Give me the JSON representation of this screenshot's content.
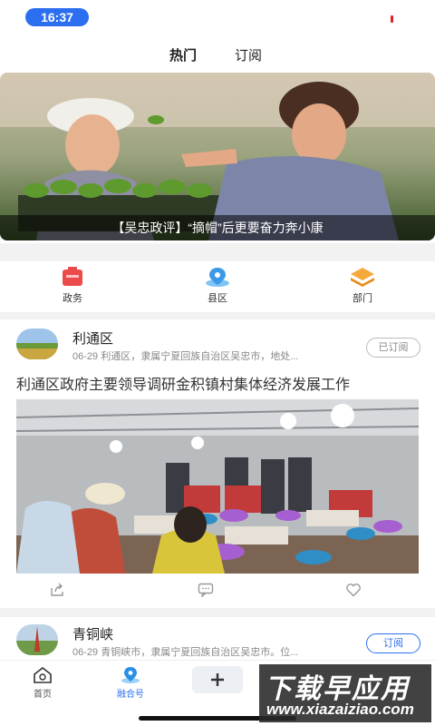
{
  "status": {
    "time": "16:37"
  },
  "top_tabs": [
    {
      "label": "热门"
    },
    {
      "label": "订阅"
    }
  ],
  "banner": {
    "caption": "【吴忠政评】“摘帽”后更要奋力奔小康"
  },
  "categories": [
    {
      "label": "政务",
      "icon": "briefcase-icon"
    },
    {
      "label": "县区",
      "icon": "map-pin-icon"
    },
    {
      "label": "部门",
      "icon": "layers-icon"
    }
  ],
  "feed": [
    {
      "name": "利通区",
      "meta": "06-29 利通区，隶属宁夏回族自治区吴忠市，地处...",
      "subscribe_label": "已订阅",
      "title": "利通区政府主要领导调研金积镇村集体经济发展工作"
    },
    {
      "name": "青铜峡",
      "meta": "06-29 青铜峡市，隶属宁夏回族自治区吴忠市。位...",
      "subscribe_label": "订阅"
    }
  ],
  "bottom_nav": [
    {
      "label": "首页",
      "icon": "home-icon"
    },
    {
      "label": "融合号",
      "icon": "location-icon"
    },
    {
      "label": "",
      "icon": "plus-icon"
    }
  ],
  "watermark": {
    "main": "下载早应用",
    "sub": "www.xiazaiziao.com"
  },
  "colors": {
    "accent": "#2b6ff0",
    "alert": "#e02020"
  }
}
